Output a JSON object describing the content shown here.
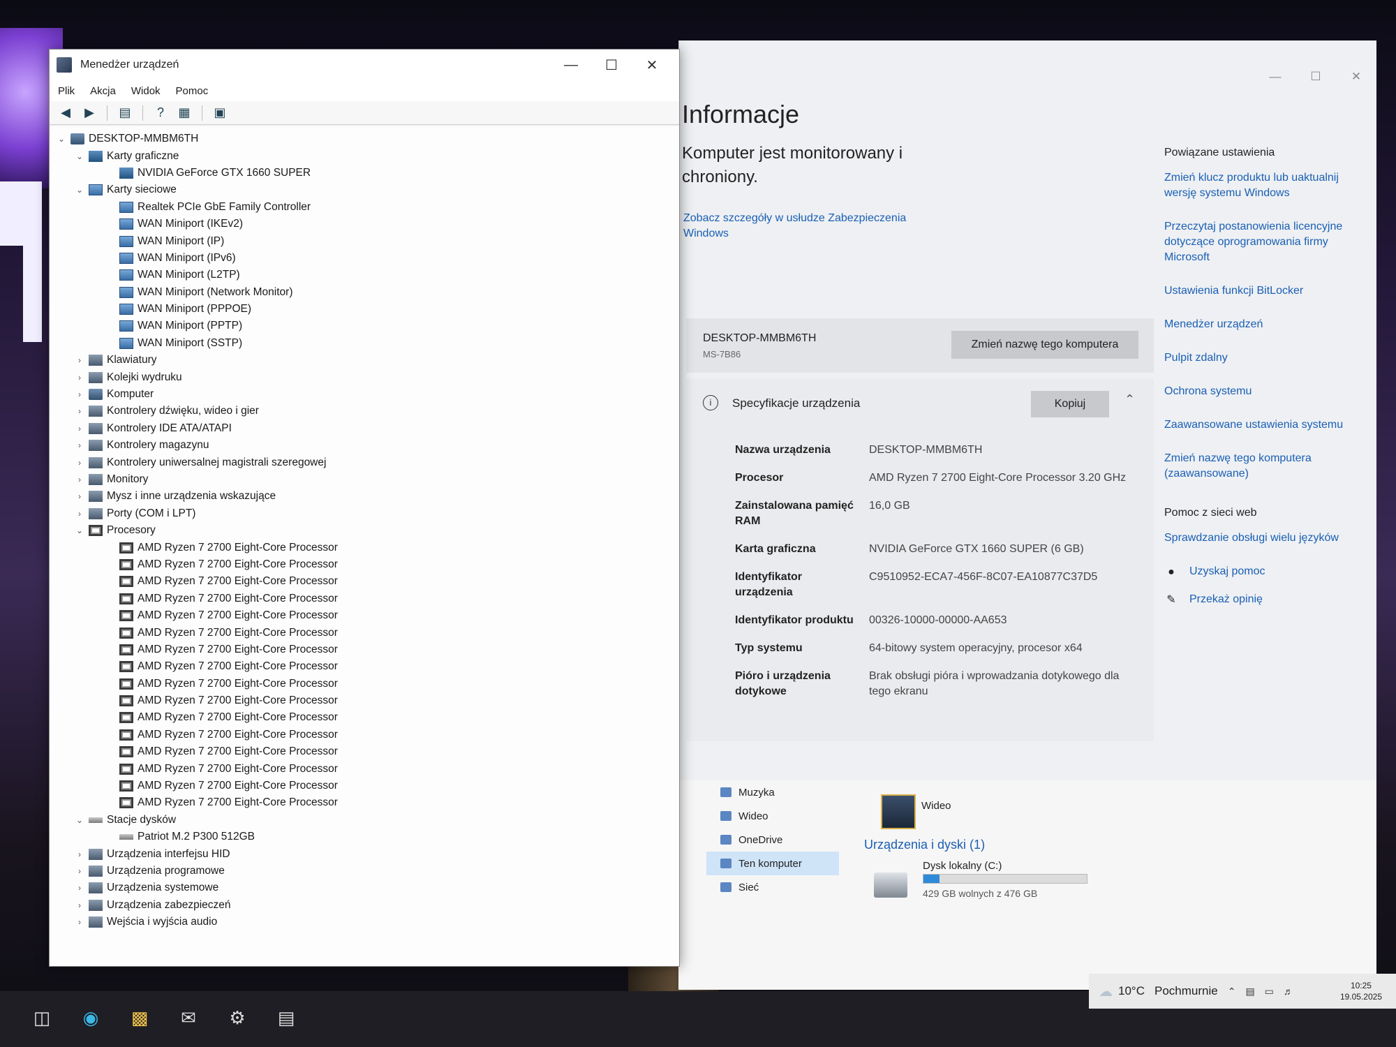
{
  "devmgr": {
    "title": "Menedżer urządzeń",
    "menu": [
      "Plik",
      "Akcja",
      "Widok",
      "Pomoc"
    ],
    "tree": [
      {
        "level": 0,
        "expanded": true,
        "label": "DESKTOP-MMBM6TH",
        "icon": "computer-icon"
      },
      {
        "level": 1,
        "expanded": true,
        "label": "Karty graficzne",
        "icon": "display-adapter-icon"
      },
      {
        "level": 2,
        "label": "NVIDIA GeForce GTX 1660 SUPER",
        "icon": "display-adapter-icon"
      },
      {
        "level": 1,
        "expanded": true,
        "label": "Karty sieciowe",
        "icon": "network-adapter-icon"
      },
      {
        "level": 2,
        "label": "Realtek PCIe GbE Family Controller",
        "icon": "network-adapter-icon"
      },
      {
        "level": 2,
        "label": "WAN Miniport (IKEv2)",
        "icon": "network-adapter-icon"
      },
      {
        "level": 2,
        "label": "WAN Miniport (IP)",
        "icon": "network-adapter-icon"
      },
      {
        "level": 2,
        "label": "WAN Miniport (IPv6)",
        "icon": "network-adapter-icon"
      },
      {
        "level": 2,
        "label": "WAN Miniport (L2TP)",
        "icon": "network-adapter-icon"
      },
      {
        "level": 2,
        "label": "WAN Miniport (Network Monitor)",
        "icon": "network-adapter-icon"
      },
      {
        "level": 2,
        "label": "WAN Miniport (PPPOE)",
        "icon": "network-adapter-icon"
      },
      {
        "level": 2,
        "label": "WAN Miniport (PPTP)",
        "icon": "network-adapter-icon"
      },
      {
        "level": 2,
        "label": "WAN Miniport (SSTP)",
        "icon": "network-adapter-icon"
      },
      {
        "level": 1,
        "expanded": false,
        "label": "Klawiatury",
        "icon": "keyboard-icon"
      },
      {
        "level": 1,
        "expanded": false,
        "label": "Kolejki wydruku",
        "icon": "printer-icon"
      },
      {
        "level": 1,
        "expanded": false,
        "label": "Komputer",
        "icon": "computer-icon"
      },
      {
        "level": 1,
        "expanded": false,
        "label": "Kontrolery dźwięku, wideo i gier",
        "icon": "speaker-icon"
      },
      {
        "level": 1,
        "expanded": false,
        "label": "Kontrolery IDE ATA/ATAPI",
        "icon": "ide-controller-icon"
      },
      {
        "level": 1,
        "expanded": false,
        "label": "Kontrolery magazynu",
        "icon": "storage-controller-icon"
      },
      {
        "level": 1,
        "expanded": false,
        "label": "Kontrolery uniwersalnej magistrali szeregowej",
        "icon": "usb-icon"
      },
      {
        "level": 1,
        "expanded": false,
        "label": "Monitory",
        "icon": "monitor-icon"
      },
      {
        "level": 1,
        "expanded": false,
        "label": "Mysz i inne urządzenia wskazujące",
        "icon": "mouse-icon"
      },
      {
        "level": 1,
        "expanded": false,
        "label": "Porty (COM i LPT)",
        "icon": "port-icon"
      },
      {
        "level": 1,
        "expanded": true,
        "label": "Procesory",
        "icon": "processor-icon"
      },
      {
        "level": 2,
        "label": "AMD Ryzen 7 2700 Eight-Core Processor",
        "icon": "processor-icon"
      },
      {
        "level": 2,
        "label": "AMD Ryzen 7 2700 Eight-Core Processor",
        "icon": "processor-icon"
      },
      {
        "level": 2,
        "label": "AMD Ryzen 7 2700 Eight-Core Processor",
        "icon": "processor-icon"
      },
      {
        "level": 2,
        "label": "AMD Ryzen 7 2700 Eight-Core Processor",
        "icon": "processor-icon"
      },
      {
        "level": 2,
        "label": "AMD Ryzen 7 2700 Eight-Core Processor",
        "icon": "processor-icon"
      },
      {
        "level": 2,
        "label": "AMD Ryzen 7 2700 Eight-Core Processor",
        "icon": "processor-icon"
      },
      {
        "level": 2,
        "label": "AMD Ryzen 7 2700 Eight-Core Processor",
        "icon": "processor-icon"
      },
      {
        "level": 2,
        "label": "AMD Ryzen 7 2700 Eight-Core Processor",
        "icon": "processor-icon"
      },
      {
        "level": 2,
        "label": "AMD Ryzen 7 2700 Eight-Core Processor",
        "icon": "processor-icon"
      },
      {
        "level": 2,
        "label": "AMD Ryzen 7 2700 Eight-Core Processor",
        "icon": "processor-icon"
      },
      {
        "level": 2,
        "label": "AMD Ryzen 7 2700 Eight-Core Processor",
        "icon": "processor-icon"
      },
      {
        "level": 2,
        "label": "AMD Ryzen 7 2700 Eight-Core Processor",
        "icon": "processor-icon"
      },
      {
        "level": 2,
        "label": "AMD Ryzen 7 2700 Eight-Core Processor",
        "icon": "processor-icon"
      },
      {
        "level": 2,
        "label": "AMD Ryzen 7 2700 Eight-Core Processor",
        "icon": "processor-icon"
      },
      {
        "level": 2,
        "label": "AMD Ryzen 7 2700 Eight-Core Processor",
        "icon": "processor-icon"
      },
      {
        "level": 2,
        "label": "AMD Ryzen 7 2700 Eight-Core Processor",
        "icon": "processor-icon"
      },
      {
        "level": 1,
        "expanded": true,
        "label": "Stacje dysków",
        "icon": "disk-drive-icon"
      },
      {
        "level": 2,
        "label": "Patriot M.2 P300 512GB",
        "icon": "disk-drive-icon"
      },
      {
        "level": 1,
        "expanded": false,
        "label": "Urządzenia interfejsu HID",
        "icon": "hid-icon"
      },
      {
        "level": 1,
        "expanded": false,
        "label": "Urządzenia programowe",
        "icon": "software-device-icon"
      },
      {
        "level": 1,
        "expanded": false,
        "label": "Urządzenia systemowe",
        "icon": "system-device-icon"
      },
      {
        "level": 1,
        "expanded": false,
        "label": "Urządzenia zabezpieczeń",
        "icon": "security-device-icon"
      },
      {
        "level": 1,
        "expanded": false,
        "label": "Wejścia i wyjścia audio",
        "icon": "audio-io-icon"
      }
    ]
  },
  "settings": {
    "title": "Informacje",
    "security_text": "Komputer jest monitorowany i chroniony.",
    "security_link": "Zobacz szczegóły w usłudze Zabezpieczenia Windows",
    "pc_name": "DESKTOP-MMBM6TH",
    "pc_model": "MS-7B86",
    "rename_button": "Zmień nazwę tego komputera",
    "spec_title": "Specyfikacje urządzenia",
    "copy_button": "Kopiuj",
    "specs": [
      {
        "key": "Nazwa urządzenia",
        "value": "DESKTOP-MMBM6TH"
      },
      {
        "key": "Procesor",
        "value": "AMD Ryzen 7 2700 Eight-Core Processor 3.20 GHz"
      },
      {
        "key": "Zainstalowana pamięć RAM",
        "value": "16,0 GB"
      },
      {
        "key": "Karta graficzna",
        "value": "NVIDIA GeForce GTX 1660 SUPER (6 GB)"
      },
      {
        "key": "Identyfikator urządzenia",
        "value": "C9510952-ECA7-456F-8C07-EA10877C37D5"
      },
      {
        "key": "Identyfikator produktu",
        "value": "00326-10000-00000-AA653"
      },
      {
        "key": "Typ systemu",
        "value": "64-bitowy system operacyjny, procesor x64"
      },
      {
        "key": "Pióro i urządzenia dotykowe",
        "value": "Brak obsługi pióra i wprowadzania dotykowego dla tego ekranu"
      }
    ],
    "related_title": "Powiązane ustawienia",
    "related_links": [
      "Zmień klucz produktu lub uaktualnij wersję systemu Windows",
      "Przeczytaj postanowienia licencyjne dotyczące oprogramowania firmy Microsoft",
      "Ustawienia funkcji BitLocker",
      "Menedżer urządzeń",
      "Pulpit zdalny",
      "Ochrona systemu",
      "Zaawansowane ustawienia systemu",
      "Zmień nazwę tego komputera (zaawansowane)"
    ],
    "help_title": "Pomoc z sieci web",
    "help_link": "Sprawdzanie obsługi wielu języków",
    "get_help": "Uzyskaj pomoc",
    "feedback": "Przekaż opinię"
  },
  "explorer": {
    "nav": [
      "Muzyka",
      "Wideo",
      "OneDrive",
      "Ten komputer",
      "Sieć"
    ],
    "video_label": "Wideo",
    "section_label": "Urządzenia i dyski (1)",
    "drive_name": "Dysk lokalny (C:)",
    "drive_free": "429 GB wolnych z 476 GB",
    "drive_used_fraction": 0.099
  },
  "tray": {
    "temperature": "10°C",
    "weather": "Pochmurnie",
    "time": "10:25",
    "date": "19.05.2025"
  }
}
